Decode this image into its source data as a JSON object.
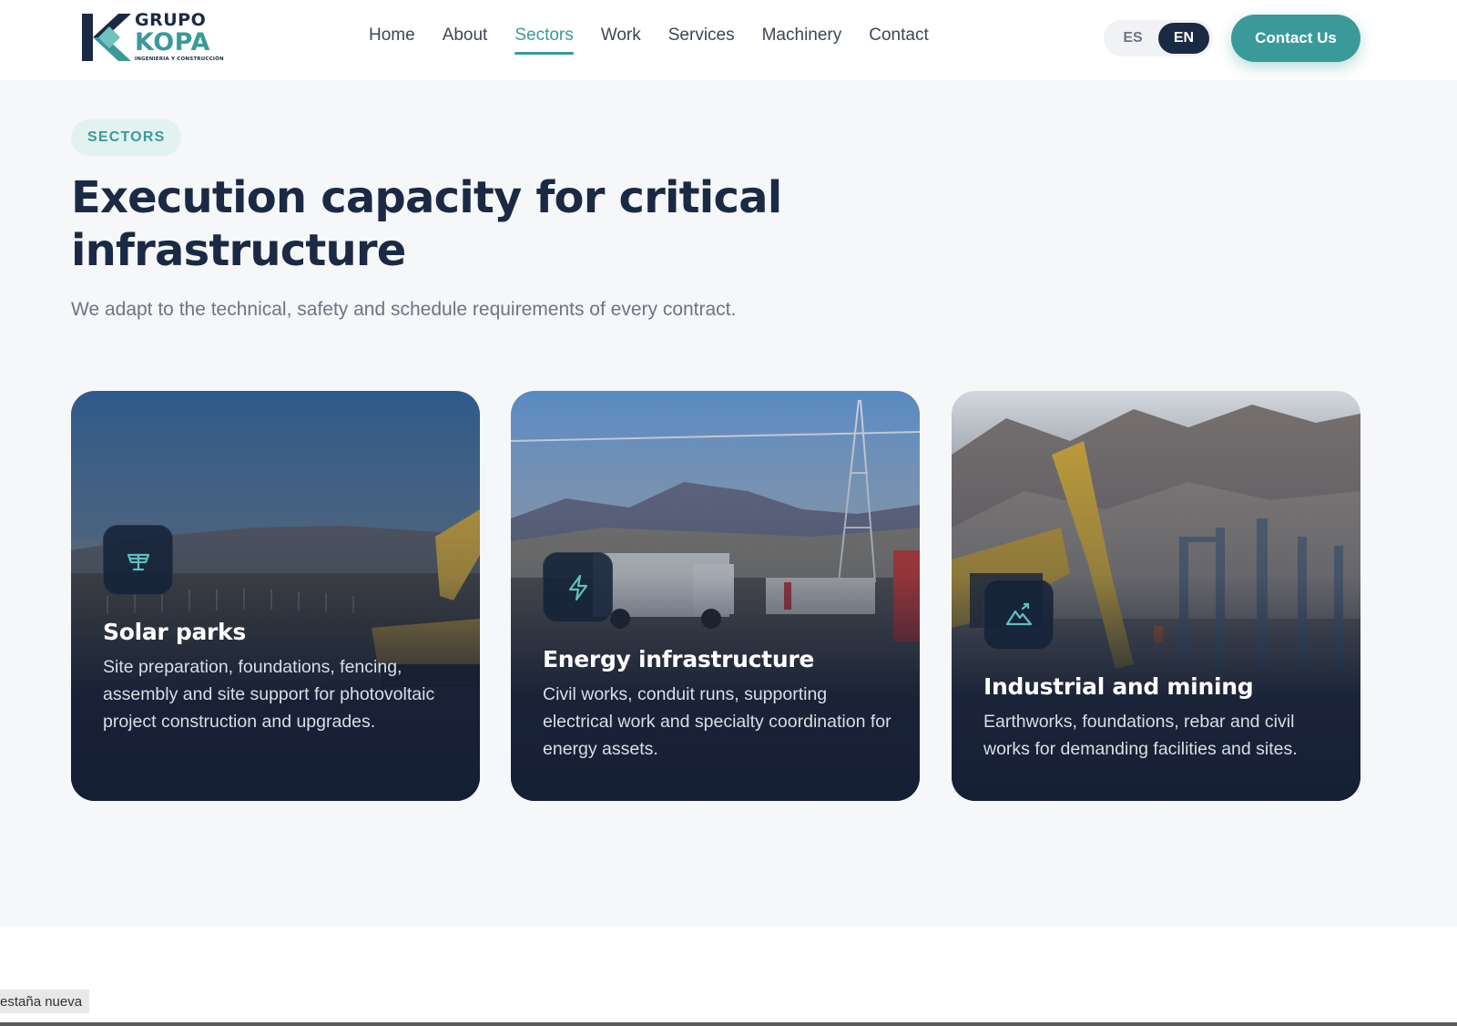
{
  "brand": {
    "line1": "GRUPO",
    "line2": "KOPA",
    "tagline": "INGENIERÍA Y CONSTRUCCIÓN",
    "colors": {
      "navy": "#1b2a44",
      "teal": "#3a9a99"
    }
  },
  "nav": {
    "items": [
      "Home",
      "About",
      "Sectors",
      "Work",
      "Services",
      "Machinery",
      "Contact"
    ],
    "active": "Sectors"
  },
  "lang": {
    "es": "ES",
    "en": "EN",
    "selected": "EN"
  },
  "cta": {
    "label": "Contact Us"
  },
  "section": {
    "pill": "SECTORS",
    "title": "Execution capacity for critical infrastructure",
    "subtitle": "We adapt to the technical, safety and schedule requirements of every contract."
  },
  "cards": [
    {
      "icon": "solar-panel-icon",
      "title": "Solar parks",
      "text": "Site preparation, foundations, fencing, assembly and site support for photovoltaic project construction and upgrades."
    },
    {
      "icon": "lightning-bolt-icon",
      "title": "Energy infrastructure",
      "text": "Civil works, conduit runs, supporting electrical work and specialty coordination for energy assets."
    },
    {
      "icon": "mountain-icon",
      "title": "Industrial and mining",
      "text": "Earthworks, foundations, rebar and civil works for demanding facilities and sites."
    }
  ],
  "browser": {
    "tooltip": "estaña nueva"
  }
}
